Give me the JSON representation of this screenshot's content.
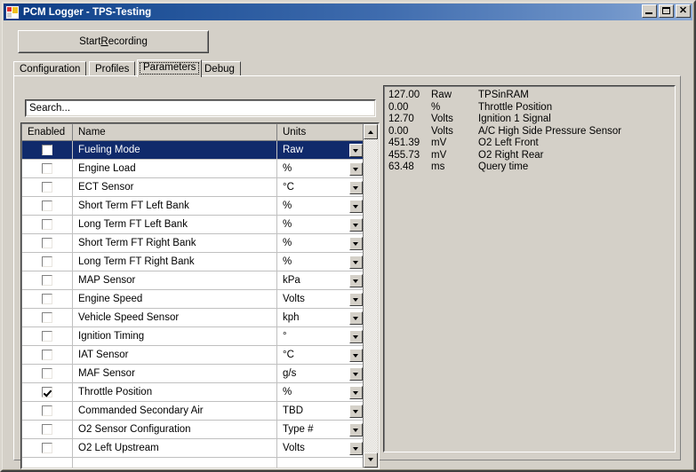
{
  "window": {
    "title": "PCM Logger - TPS-Testing",
    "icon": "form-icon",
    "controls": [
      {
        "name": "minimize-button",
        "label": "_"
      },
      {
        "name": "maximize-button",
        "label": "□"
      },
      {
        "name": "close-button",
        "label": "✕"
      }
    ]
  },
  "toolbar": {
    "start_recording_pre": "Start ",
    "start_recording_accel": "R",
    "start_recording_post": "ecording"
  },
  "tabs": [
    {
      "label": "Configuration",
      "active": false
    },
    {
      "label": "Profiles",
      "active": false
    },
    {
      "label": "Parameters",
      "active": true
    },
    {
      "label": "Debug",
      "active": false
    }
  ],
  "search": {
    "value": "Search...",
    "placeholder": "Search..."
  },
  "grid": {
    "columns": [
      "Enabled",
      "Name",
      "Units"
    ],
    "rows": [
      {
        "enabled": false,
        "name": "Fueling Mode",
        "units": "Raw",
        "selected": true
      },
      {
        "enabled": false,
        "name": "Engine Load",
        "units": "%",
        "selected": false
      },
      {
        "enabled": false,
        "name": "ECT Sensor",
        "units": "°C",
        "selected": false
      },
      {
        "enabled": false,
        "name": "Short Term FT Left Bank",
        "units": "%",
        "selected": false
      },
      {
        "enabled": false,
        "name": "Long Term FT Left Bank",
        "units": "%",
        "selected": false
      },
      {
        "enabled": false,
        "name": "Short Term FT Right Bank",
        "units": "%",
        "selected": false
      },
      {
        "enabled": false,
        "name": "Long Term FT Right Bank",
        "units": "%",
        "selected": false
      },
      {
        "enabled": false,
        "name": "MAP Sensor",
        "units": "kPa",
        "selected": false
      },
      {
        "enabled": false,
        "name": "Engine Speed",
        "units": "Volts",
        "selected": false
      },
      {
        "enabled": false,
        "name": "Vehicle Speed Sensor",
        "units": "kph",
        "selected": false
      },
      {
        "enabled": false,
        "name": "Ignition Timing",
        "units": "°",
        "selected": false
      },
      {
        "enabled": false,
        "name": "IAT Sensor",
        "units": "°C",
        "selected": false
      },
      {
        "enabled": false,
        "name": "MAF Sensor",
        "units": "g/s",
        "selected": false
      },
      {
        "enabled": true,
        "name": "Throttle Position",
        "units": "%",
        "selected": false
      },
      {
        "enabled": false,
        "name": "Commanded Secondary Air",
        "units": "TBD",
        "selected": false
      },
      {
        "enabled": false,
        "name": "O2 Sensor Configuration",
        "units": "Type #",
        "selected": false
      },
      {
        "enabled": false,
        "name": "O2 Left Upstream",
        "units": "Volts",
        "selected": false
      },
      {
        "enabled": false,
        "name": "",
        "units": "",
        "selected": false
      }
    ],
    "scrollbar": {
      "up_arrow": "scroll-up-arrow",
      "down_arrow": "scroll-down-arrow",
      "thumb": "scroll-thumb"
    }
  },
  "readout": {
    "lines": [
      {
        "value": "127.00",
        "unit": "Raw",
        "description": "TPSinRAM"
      },
      {
        "value": "0.00",
        "unit": "%",
        "description": "Throttle Position"
      },
      {
        "value": "12.70",
        "unit": "Volts",
        "description": "Ignition 1 Signal"
      },
      {
        "value": "0.00",
        "unit": "Volts",
        "description": "A/C High Side Pressure Sensor"
      },
      {
        "value": "451.39",
        "unit": "mV",
        "description": "O2 Left Front"
      },
      {
        "value": "455.73",
        "unit": "mV",
        "description": "O2 Right Rear"
      },
      {
        "value": "63.48",
        "unit": "ms",
        "description": "Query time"
      }
    ]
  },
  "colors": {
    "titlebar_start": "#0b3a82",
    "titlebar_end": "#8aa9d6",
    "face": "#d4d0c8",
    "selection": "#102a6b",
    "text": "#000000"
  }
}
